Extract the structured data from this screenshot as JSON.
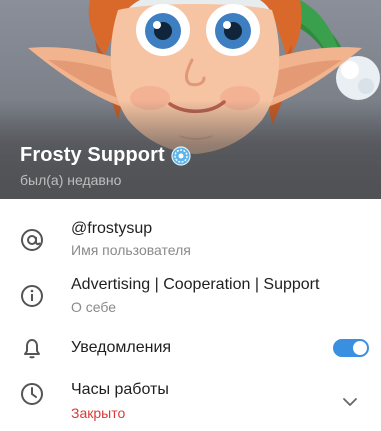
{
  "profile": {
    "name": "Frosty Support",
    "status": "был(а) недавно"
  },
  "info": {
    "username": {
      "value": "@frostysup",
      "label": "Имя пользователя",
      "icon": "at-icon"
    },
    "about": {
      "value": "Advertising | Cooperation | Support",
      "label": "О себе",
      "icon": "info-icon"
    },
    "notifications": {
      "label": "Уведомления",
      "enabled": true,
      "icon": "bell-icon"
    },
    "hours": {
      "label": "Часы работы",
      "state": "Закрыто",
      "icon": "clock-icon"
    }
  },
  "colors": {
    "accent": "#3a8fe0",
    "closed": "#d93a3a"
  }
}
